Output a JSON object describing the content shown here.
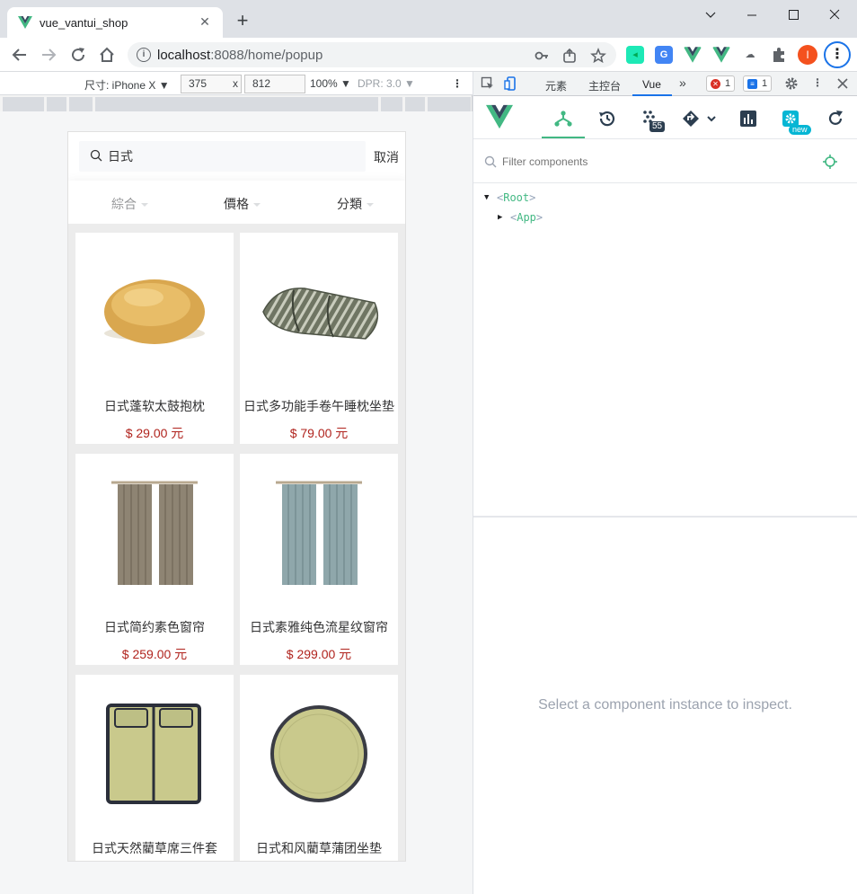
{
  "browser": {
    "tab_title": "vue_vantui_shop",
    "url_host": "localhost",
    "url_rest": ":8088/home/popup",
    "avatar_letter": "I"
  },
  "device_toolbar": {
    "device_label": "尺寸: iPhone X",
    "width": "375",
    "times": "x",
    "height": "812",
    "zoom": "100%",
    "dpr": "DPR: 3.0"
  },
  "shop": {
    "search": {
      "value": "日式"
    },
    "cancel_label": "取消",
    "sort_tabs": [
      {
        "label": "綜合"
      },
      {
        "label": "價格"
      },
      {
        "label": "分類"
      }
    ],
    "products": [
      {
        "name": "日式蓬软太鼓抱枕",
        "price": "$ 29.00 元",
        "icon": "round-cushion"
      },
      {
        "name": "日式多功能手卷午睡枕坐垫",
        "price": "$ 79.00 元",
        "icon": "striped-pillow"
      },
      {
        "name": "日式简约素色窗帘",
        "price": "$ 259.00 元",
        "icon": "brown-curtain"
      },
      {
        "name": "日式素雅纯色流星纹窗帘",
        "price": "$ 299.00 元",
        "icon": "blue-curtain"
      },
      {
        "name": "日式天然藺草席三件套",
        "price": "",
        "icon": "tatami-mat-set"
      },
      {
        "name": "日式和风藺草蒲团坐垫",
        "price": "",
        "icon": "round-tatami-cushion"
      }
    ]
  },
  "devtools": {
    "tabs": {
      "elements": "元素",
      "console": "主控台",
      "vue": "Vue",
      "more": "»"
    },
    "errors_count": "1",
    "messages_count": "1",
    "vue": {
      "timeline_badge": "55",
      "new_badge": "new",
      "filter_placeholder": "Filter components",
      "tree": [
        {
          "name": "Root"
        },
        {
          "name": "App"
        }
      ],
      "inspector_message": "Select a component instance to inspect."
    }
  },
  "colors": {
    "price": "#b0231d",
    "vue_green": "#42b883",
    "chrome_blue": "#1a73e8"
  }
}
